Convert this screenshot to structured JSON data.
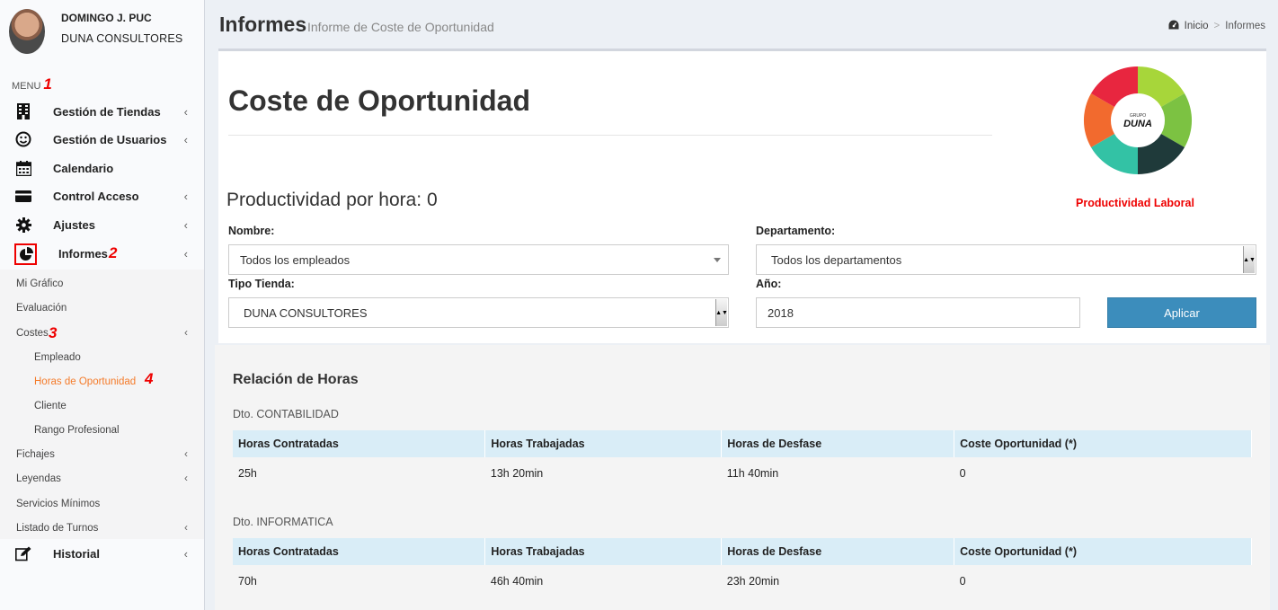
{
  "user": {
    "name": "DOMINGO J. PUC",
    "company": "DUNA CONSULTORES"
  },
  "menu": {
    "header": "MENU",
    "header_num": "1",
    "items": [
      {
        "label": "Gestión de Tiendas",
        "icon": "building-icon",
        "chevron": "‹"
      },
      {
        "label": "Gestión de Usuarios",
        "icon": "smile-icon",
        "chevron": "‹"
      },
      {
        "label": "Calendario",
        "icon": "calendar-icon",
        "chevron": ""
      },
      {
        "label": "Control Acceso",
        "icon": "credit-card-icon",
        "chevron": "‹"
      },
      {
        "label": "Ajustes",
        "icon": "gear-icon",
        "chevron": "‹"
      }
    ],
    "informes": {
      "label": "Informes",
      "num": "2",
      "chevron": "‹"
    },
    "sub": {
      "mi_grafico": "Mi Gráfico",
      "evaluacion": "Evaluación",
      "costes": "Costes",
      "costes_num": "3",
      "empleado": "Empleado",
      "horas_oportunidad": "Horas de Oportunidad",
      "horas_num": "4",
      "cliente": "Cliente",
      "rango": "Rango Profesional",
      "fichajes": "Fichajes",
      "leyendas": "Leyendas",
      "servicios": "Servicios Mínimos",
      "turnos": "Listado de Turnos"
    },
    "historial": "Historial",
    "chevron": "‹"
  },
  "header": {
    "title": "Informes",
    "subtitle": "Informe de Coste de Oportunidad"
  },
  "breadcrumb": {
    "home": "Inicio",
    "sep": ">",
    "current": "Informes"
  },
  "report": {
    "heading": "Coste de Oportunidad",
    "productivity": "Productividad por hora: 0",
    "logo_caption": "Productividad Laboral",
    "logo_center": "DUNA",
    "logo_center_small": "GRUPO"
  },
  "filters": {
    "nombre_label": "Nombre:",
    "nombre_value": "Todos los empleados",
    "departamento_label": "Departamento:",
    "departamento_value": "Todos los departamentos",
    "tienda_label": "Tipo Tienda:",
    "tienda_value": "DUNA CONSULTORES",
    "anio_label": "Año:",
    "anio_value": "2018",
    "apply": "Aplicar"
  },
  "relation": {
    "title": "Relación de Horas",
    "columns": [
      "Horas Contratadas",
      "Horas Trabajadas",
      "Horas de Desfase",
      "Coste Oportunidad (*)"
    ],
    "departments": [
      {
        "name": "Dto. CONTABILIDAD",
        "values": [
          "25h",
          "13h 20min",
          "11h 40min",
          "0"
        ]
      },
      {
        "name": "Dto. INFORMATICA",
        "values": [
          "70h",
          "46h 40min",
          "23h 20min",
          "0"
        ]
      }
    ]
  },
  "colors": {
    "accent": "#3c8dbc",
    "active": "#f47b2a",
    "annotation": "#e00000",
    "table_header": "#d9edf7"
  }
}
